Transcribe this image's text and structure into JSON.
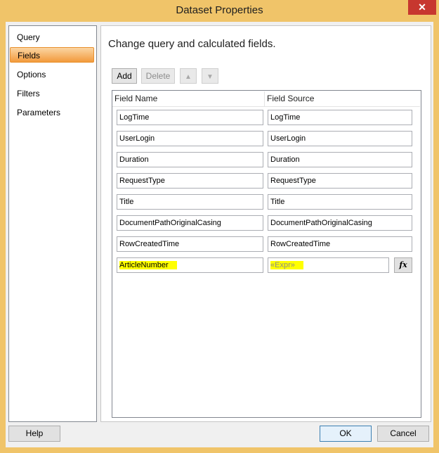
{
  "window": {
    "title": "Dataset Properties",
    "close_glyph": "✕"
  },
  "nav": {
    "items": [
      {
        "label": "Query"
      },
      {
        "label": "Fields",
        "selected": true
      },
      {
        "label": "Options"
      },
      {
        "label": "Filters"
      },
      {
        "label": "Parameters"
      }
    ]
  },
  "main": {
    "heading": "Change query and calculated fields.",
    "toolbar": {
      "add": "Add",
      "delete": "Delete",
      "up_icon": "arrow-up-icon",
      "down_icon": "arrow-down-icon"
    },
    "grid": {
      "headers": [
        "Field Name",
        "Field Source"
      ],
      "rows": [
        {
          "name": "LogTime",
          "source": "LogTime"
        },
        {
          "name": "UserLogin",
          "source": "UserLogin"
        },
        {
          "name": "Duration",
          "source": "Duration"
        },
        {
          "name": "RequestType",
          "source": "RequestType"
        },
        {
          "name": "Title",
          "source": "Title"
        },
        {
          "name": "DocumentPathOriginalCasing",
          "source": "DocumentPathOriginalCasing"
        },
        {
          "name": "RowCreatedTime",
          "source": "RowCreatedTime"
        },
        {
          "name": "ArticleNumber",
          "source": "«Expr»",
          "highlight": true
        }
      ],
      "fx_label": "fx"
    }
  },
  "footer": {
    "help": "Help",
    "ok": "OK",
    "cancel": "Cancel"
  },
  "colors": {
    "title_bar": "#f0c469",
    "selected_nav": "#f29a3c",
    "highlight": "#ffff00",
    "close": "#c7372f"
  }
}
